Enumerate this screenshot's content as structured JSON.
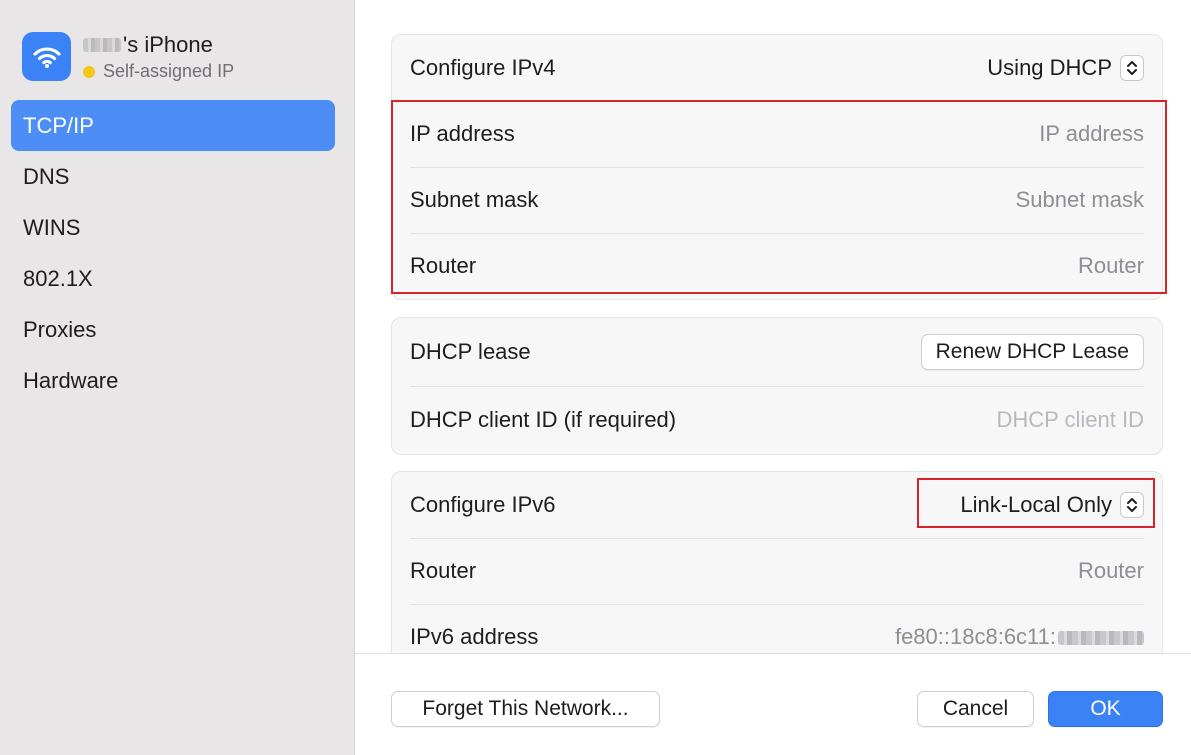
{
  "sidebar": {
    "device_name_suffix": "'s iPhone",
    "device_status": "Self-assigned IP",
    "status_color": "#f5c518",
    "items": [
      {
        "label": "TCP/IP",
        "active": true
      },
      {
        "label": "DNS"
      },
      {
        "label": "WINS"
      },
      {
        "label": "802.1X"
      },
      {
        "label": "Proxies"
      },
      {
        "label": "Hardware"
      }
    ]
  },
  "ipv4": {
    "configure_label": "Configure IPv4",
    "configure_value": "Using DHCP",
    "ip_label": "IP address",
    "ip_placeholder": "IP address",
    "subnet_label": "Subnet mask",
    "subnet_placeholder": "Subnet mask",
    "router_label": "Router",
    "router_placeholder": "Router"
  },
  "dhcp": {
    "lease_label": "DHCP lease",
    "renew_button": "Renew DHCP Lease",
    "client_id_label": "DHCP client ID (if required)",
    "client_id_placeholder": "DHCP client ID"
  },
  "ipv6": {
    "configure_label": "Configure IPv6",
    "configure_value": "Link-Local Only",
    "router_label": "Router",
    "router_placeholder": "Router",
    "address_label": "IPv6 address",
    "address_value": "fe80::18c8:6c11:"
  },
  "footer": {
    "forget_button": "Forget This Network...",
    "cancel_button": "Cancel",
    "ok_button": "OK"
  },
  "colors": {
    "accent": "#3b82f6",
    "highlight": "#d8232a",
    "sidebar_active": "#4c8df6"
  }
}
